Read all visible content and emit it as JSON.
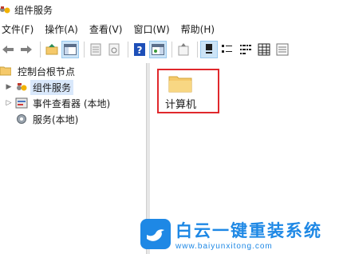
{
  "window": {
    "title": "组件服务"
  },
  "menu": [
    {
      "label": "文件(F)"
    },
    {
      "label": "操作(A)"
    },
    {
      "label": "查看(V)"
    },
    {
      "label": "窗口(W)"
    },
    {
      "label": "帮助(H)"
    }
  ],
  "toolbar": {
    "buttons": [
      "back-arrow-icon",
      "forward-arrow-icon",
      "up-folder-icon",
      "show-tree-icon",
      "properties-icon",
      "refresh-icon",
      "help-icon",
      "action-pane-icon",
      "export-icon",
      "large-icons-view",
      "small-icons-view",
      "list-view",
      "detail-view",
      "status-view"
    ]
  },
  "tree": {
    "root": "控制台根节点",
    "items": [
      {
        "label": "组件服务",
        "selected": true
      },
      {
        "label": "事件查看器 (本地)"
      },
      {
        "label": "服务(本地)"
      }
    ]
  },
  "content": {
    "items": [
      {
        "label": "计算机",
        "icon": "folder-icon"
      }
    ]
  },
  "watermark": {
    "title": "白云一键重装系统",
    "url": "www.baiyunxitong.com",
    "color": "#1e88e5"
  },
  "colors": {
    "highlight": "#e0282c",
    "selection": "#d9e8fb",
    "folder": "#f5c96a"
  }
}
